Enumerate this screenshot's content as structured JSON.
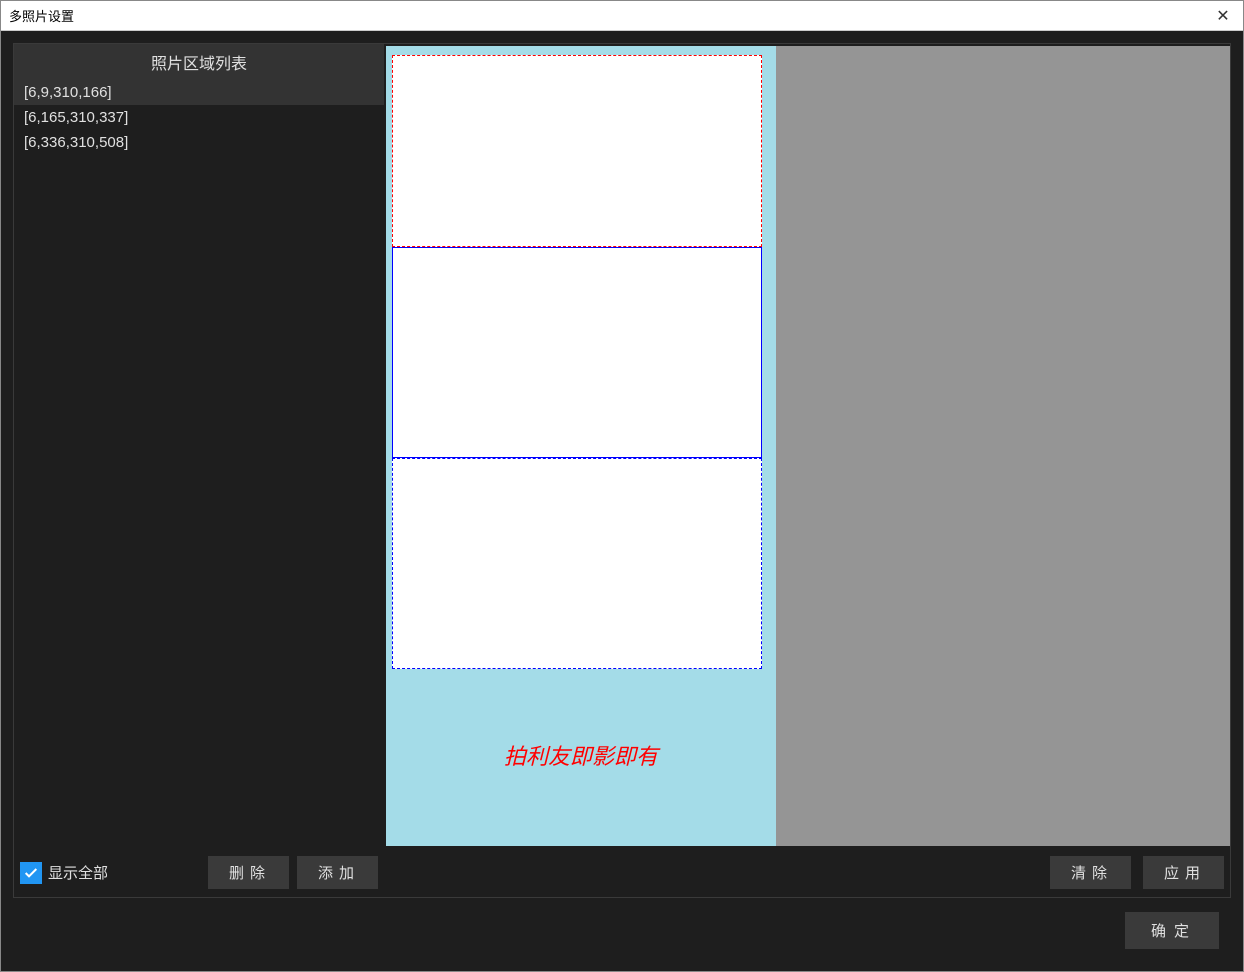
{
  "window": {
    "title": "多照片设置"
  },
  "left_panel": {
    "header": "照片区域列表",
    "regions": [
      "[6,9,310,166]",
      "[6,165,310,337]",
      "[6,336,310,508]"
    ],
    "selected_index": 0,
    "show_all_label": "显示全部",
    "delete_button": "删除",
    "add_button": "添加"
  },
  "preview": {
    "watermark": "拍利友即影即有",
    "clear_button": "清除",
    "apply_button": "应用"
  },
  "footer": {
    "ok_button": "确定"
  }
}
